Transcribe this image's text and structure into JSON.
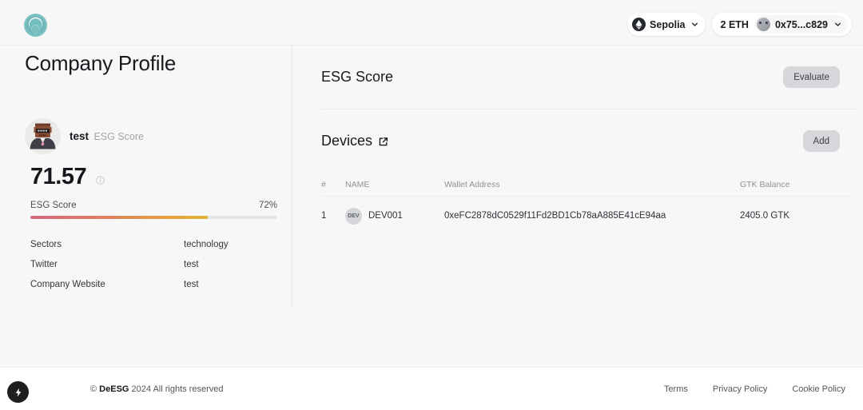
{
  "brand": {
    "logo_icon": "deesg-logo-icon"
  },
  "topbar": {
    "network": {
      "label": "Sepolia",
      "icon": "ethereum-icon",
      "chevron_icon": "chevron-down-icon"
    },
    "account": {
      "balance": "2 ETH",
      "address": "0x75...c829",
      "avatar_icon": "account-avatar",
      "chevron_icon": "chevron-down-icon"
    }
  },
  "page": {
    "title": "Company Profile"
  },
  "profile": {
    "avatar_icon": "pixel-avatar",
    "name": "test",
    "subtitle": "ESG Score",
    "score": "71.57",
    "info_icon": "info-icon",
    "progress": {
      "label": "ESG Score",
      "percent_label": "72%",
      "percent": 72,
      "gradient_from": "#d8667f",
      "gradient_to": "#e2b23a",
      "track_color": "#e2e3e5"
    },
    "facts": [
      {
        "key": "Sectors",
        "value": "technology"
      },
      {
        "key": "Twitter",
        "value": "test"
      },
      {
        "key": "Company Website",
        "value": "test"
      }
    ]
  },
  "esg_section": {
    "title": "ESG Score",
    "action_label": "Evaluate"
  },
  "devices_section": {
    "title": "Devices",
    "external_link_icon": "external-link-icon",
    "action_label": "Add",
    "table": {
      "columns": [
        "#",
        "NAME",
        "Wallet Address",
        "GTK Balance"
      ],
      "rows": [
        {
          "num": "1",
          "chip": "DEV",
          "name": "DEV001",
          "address": "0xeFC2878dC0529f11Fd2BD1Cb78aA885E41cE94aa",
          "balance": "2405.0 GTK"
        }
      ]
    }
  },
  "footer": {
    "copyright_mark": "©",
    "brand": "DeESG",
    "copyright_rest": "2024 All rights reserved",
    "links": [
      "Terms",
      "Privacy Policy",
      "Cookie Policy"
    ],
    "bolt_icon": "lightning-bolt-icon"
  }
}
